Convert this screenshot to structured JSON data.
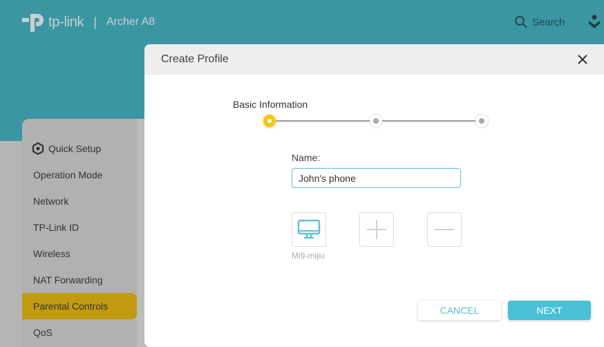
{
  "header": {
    "brand": "tp-link",
    "separator": "|",
    "model": "Archer A8",
    "search_label": "Search"
  },
  "sidebar": {
    "items": [
      {
        "label": "Quick Setup",
        "icon": "gear-icon",
        "active": false
      },
      {
        "label": "Operation Mode",
        "active": false
      },
      {
        "label": "Network",
        "active": false
      },
      {
        "label": "TP-Link ID",
        "active": false
      },
      {
        "label": "Wireless",
        "active": false
      },
      {
        "label": "NAT Forwarding",
        "active": false
      },
      {
        "label": "Parental Controls",
        "active": true
      },
      {
        "label": "QoS",
        "active": false
      }
    ]
  },
  "modal": {
    "title": "Create Profile",
    "stepper": {
      "current_step_label": "Basic Information",
      "current_step": 1,
      "total_steps": 3
    },
    "name_field": {
      "label": "Name:",
      "value": "John's phone"
    },
    "devices": [
      {
        "name": "Mi9-mijiu",
        "icon": "desktop-icon"
      }
    ],
    "add_device_icon": "plus-icon",
    "remove_device_icon": "minus-icon",
    "cancel_label": "CANCEL",
    "next_label": "NEXT"
  },
  "colors": {
    "header_bg": "#3b96a3",
    "accent": "#49c0d6",
    "active_step": "#f5c518",
    "active_nav": "#c39a0f"
  }
}
